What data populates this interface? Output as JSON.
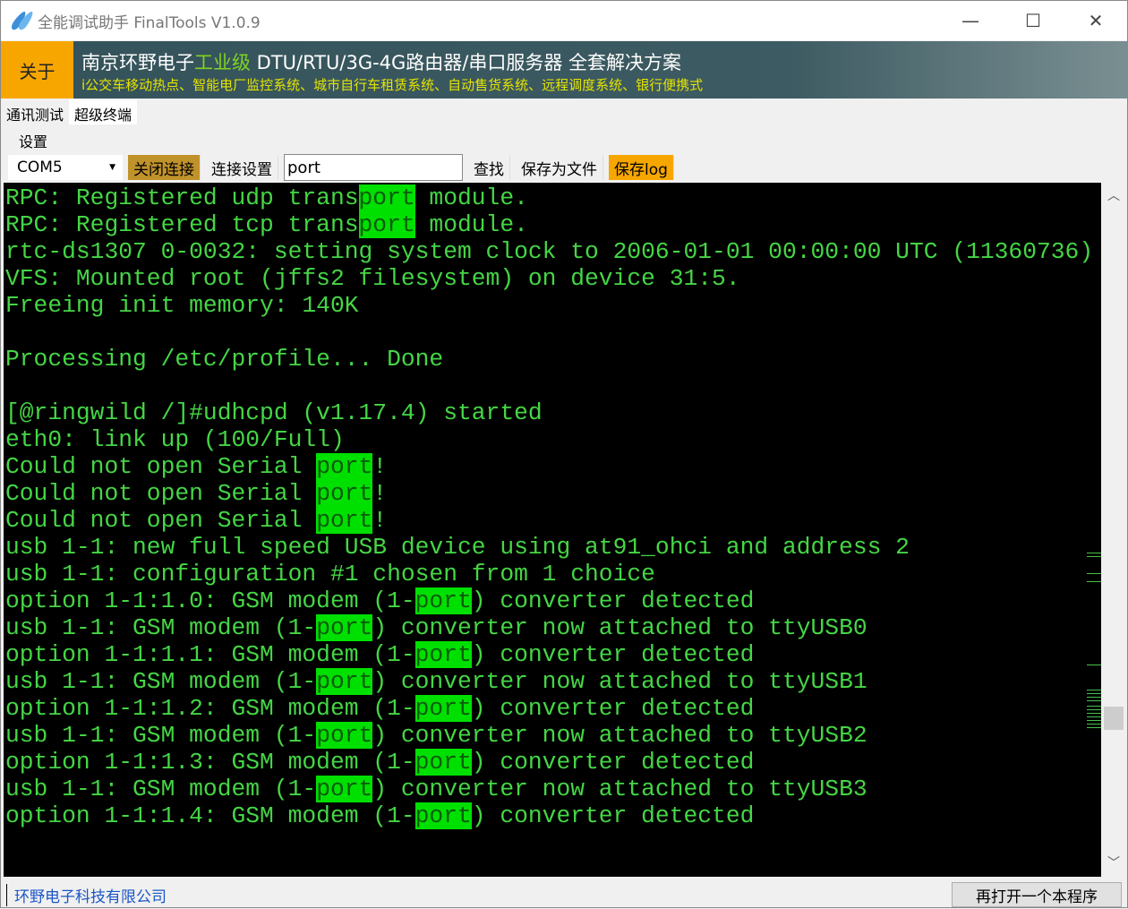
{
  "window": {
    "title": "全能调试助手 FinalTools V1.0.9",
    "minimize": "—",
    "maximize": "☐",
    "close": "✕"
  },
  "banner": {
    "about": "关于",
    "line1_a": "南京环野电子",
    "line1_b": "工业级",
    "line1_c": " DTU/RTU/3G-4G路由器/串口服务器 全套解决方案",
    "line2": "i公交车移动热点、智能电厂监控系统、城市自行车租赁系统、自动售货系统、远程调度系统、银行便携式"
  },
  "tabs": [
    {
      "label": "通讯测试",
      "active": false
    },
    {
      "label": "超级终端",
      "active": true
    }
  ],
  "settings_label": "设置",
  "toolbar": {
    "port": "COM5",
    "close_conn": "关闭连接",
    "conn_settings": "连接设置",
    "search_value": "port",
    "find": "查找",
    "save_file": "保存为文件",
    "save_log": "保存log"
  },
  "colors": {
    "terminal_text": "#45d645",
    "highlight": "#00e000",
    "accent": "#f7a600"
  },
  "terminal": {
    "lines": [
      "RPC: Registered udp transport module.",
      "RPC: Registered tcp transport module.",
      "rtc-ds1307 0-0032: setting system clock to 2006-01-01 00:00:00 UTC (11360736)",
      "VFS: Mounted root (jffs2 filesystem) on device 31:5.",
      "Freeing init memory: 140K",
      "",
      "Processing /etc/profile... Done",
      "",
      "[@ringwild /]#udhcpd (v1.17.4) started",
      "eth0: link up (100/Full)",
      "Could not open Serial port!",
      "Could not open Serial port!",
      "Could not open Serial port!",
      "usb 1-1: new full speed USB device using at91_ohci and address 2",
      "usb 1-1: configuration #1 chosen from 1 choice",
      "option 1-1:1.0: GSM modem (1-port) converter detected",
      "usb 1-1: GSM modem (1-port) converter now attached to ttyUSB0",
      "option 1-1:1.1: GSM modem (1-port) converter detected",
      "usb 1-1: GSM modem (1-port) converter now attached to ttyUSB1",
      "option 1-1:1.2: GSM modem (1-port) converter detected",
      "usb 1-1: GSM modem (1-port) converter now attached to ttyUSB2",
      "option 1-1:1.3: GSM modem (1-port) converter detected",
      "usb 1-1: GSM modem (1-port) converter now attached to ttyUSB3",
      "option 1-1:1.4: GSM modem (1-port) converter detected"
    ]
  },
  "status": {
    "company": "环野电子科技有限公司",
    "reopen": "再打开一个本程序"
  }
}
